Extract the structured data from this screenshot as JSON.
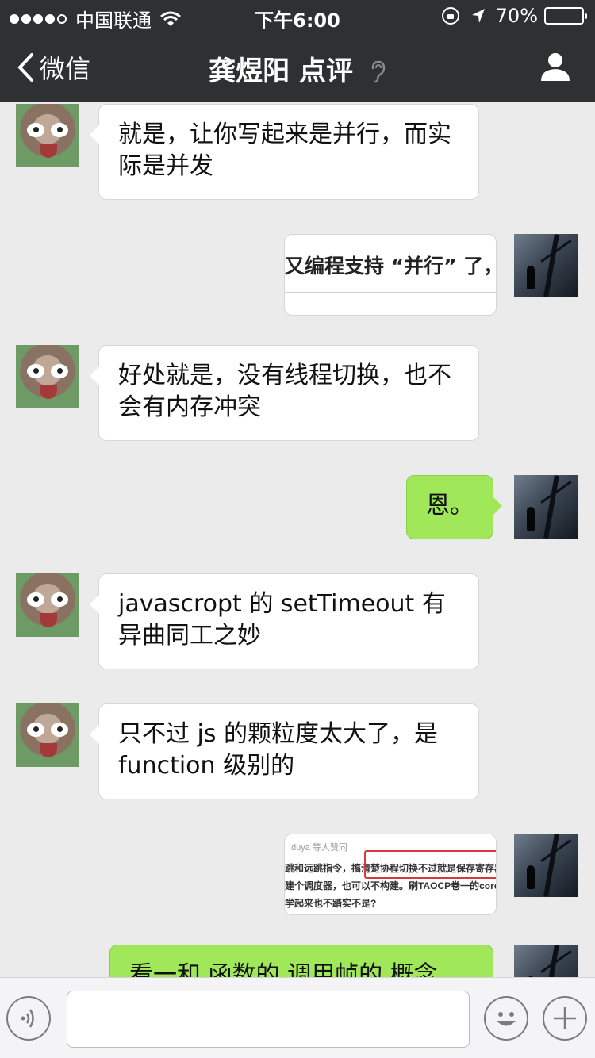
{
  "status_bar": {
    "carrier": "中国联通",
    "time": "下午6:00",
    "battery": "70%",
    "battery_level": 0.7
  },
  "nav": {
    "back_label": "微信",
    "title": "龚煜阳 点评"
  },
  "messages": [
    {
      "side": "left",
      "type": "text",
      "text": "就是，让你写起来是并行，而实际是并发"
    },
    {
      "side": "right",
      "type": "image",
      "image_text": "又编程支持 “并行” 了，"
    },
    {
      "side": "left",
      "type": "text",
      "text": "好处就是，没有线程切换，也不会有内存冲突"
    },
    {
      "side": "right",
      "type": "text",
      "text": "恩。"
    },
    {
      "side": "left",
      "type": "text",
      "text": "javascropt 的 setTimeout 有异曲同工之妙"
    },
    {
      "side": "left",
      "type": "text",
      "text": "只不过 js 的颗粒度太大了，是 function 级别的"
    },
    {
      "side": "right",
      "type": "image",
      "image_header": "duya 等人赞同",
      "image_lines": [
        "跳和远跳指令，搞清楚协程切换不过就是保存寄存器",
        "建个调度器，也可以不构建。刷TAOCP卷一的coro",
        "学起来也不踏实不是?"
      ]
    },
    {
      "side": "right",
      "type": "text",
      "text": "看一和 函数的 调用帧的 概念"
    }
  ],
  "input": {
    "placeholder": "",
    "value": ""
  },
  "icons": [
    "wifi-icon",
    "lock-rotation-icon",
    "location-icon",
    "battery-icon",
    "back-chevron-icon",
    "ear-icon",
    "profile-icon",
    "voice-icon",
    "emoji-icon",
    "plus-icon"
  ]
}
